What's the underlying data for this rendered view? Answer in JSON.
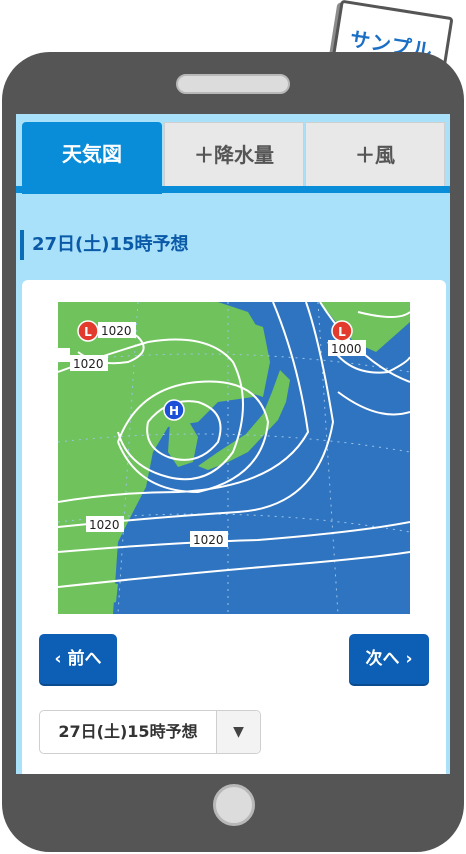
{
  "sign": {
    "text": "サンプル"
  },
  "tabs": [
    {
      "label": "天気図",
      "active": true
    },
    {
      "label": "＋降水量",
      "active": false
    },
    {
      "label": "＋風",
      "active": false
    }
  ],
  "heading": "27日(土)15時予想",
  "map": {
    "pressure_labels": [
      "1020",
      "1020",
      "1000",
      "1020",
      "1020",
      "1020"
    ],
    "high_label": "H",
    "low_label": "L",
    "colors": {
      "sea": "#2f74c0",
      "land": "#6fc25c",
      "isobar": "#ffffff",
      "low": "#e23b2e",
      "high": "#1c4fd8"
    }
  },
  "nav": {
    "prev": "‹ 前へ",
    "next": "次へ ›"
  },
  "select": {
    "value": "27日(土)15時予想",
    "arrow": "▼"
  },
  "colors": {
    "accent": "#0a8dd8",
    "button": "#0d5fb5",
    "screen_bg": "#a9e1fb"
  }
}
